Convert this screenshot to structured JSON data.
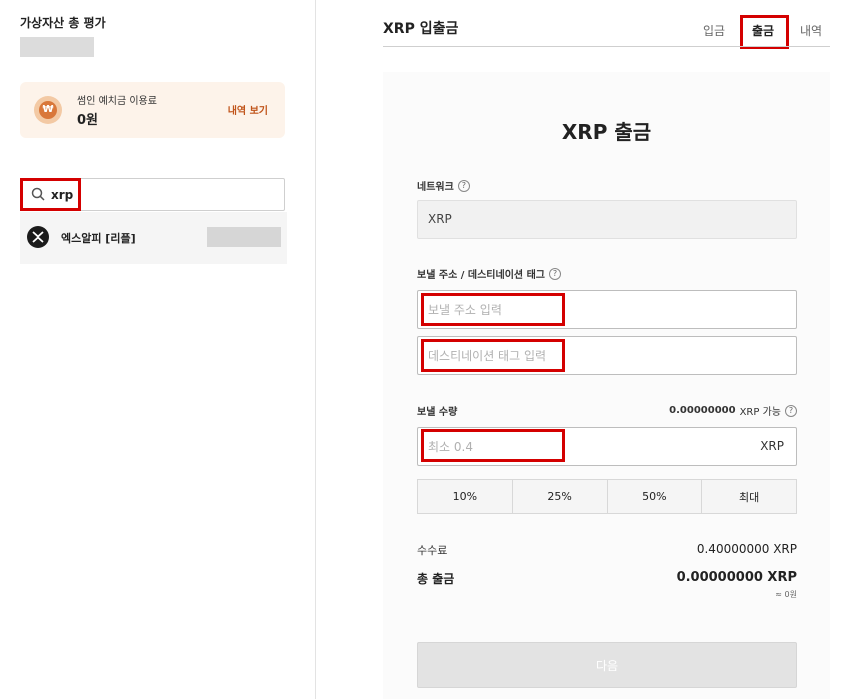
{
  "left": {
    "total_title": "가상자산 총 평가",
    "deposit": {
      "label": "썸인 예치금 이용료",
      "value": "0원",
      "link": "내역 보기",
      "icon": "money-bag-icon"
    },
    "search": {
      "value": "xrp",
      "icon": "search-icon"
    },
    "coin": {
      "name": "엑스알피 [리플]",
      "icon": "xrp-logo-icon"
    }
  },
  "right": {
    "title": "XRP 입출금",
    "tabs": [
      {
        "label": "입금",
        "active": false
      },
      {
        "label": "출금",
        "active": true
      },
      {
        "label": "내역",
        "active": false
      }
    ],
    "form_title": "XRP 출금",
    "network": {
      "label": "네트워크",
      "value": "XRP"
    },
    "address": {
      "label": "보낼 주소 / 데스티네이션 태그",
      "address_placeholder": "보낼 주소 입력",
      "tag_placeholder": "데스티네이션 태그 입력"
    },
    "amount": {
      "label": "보낼 수량",
      "available_amount": "0.00000000",
      "available_suffix": "XRP 가능",
      "placeholder": "최소 0.4",
      "unit": "XRP"
    },
    "percent_buttons": [
      "10%",
      "25%",
      "50%",
      "최대"
    ],
    "fee": {
      "label": "수수료",
      "value": "0.40000000 XRP"
    },
    "total": {
      "label": "총 출금",
      "value": "0.00000000 XRP",
      "krw": "≈ 0원"
    },
    "next_button": "다음"
  },
  "colors": {
    "highlight": "#d40000",
    "accent_orange": "#c0541a"
  }
}
